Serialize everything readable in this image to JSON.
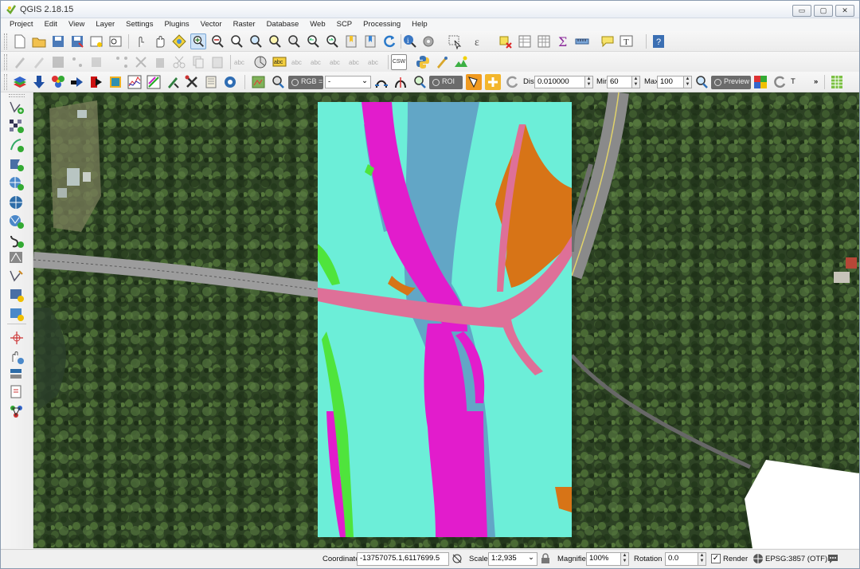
{
  "window": {
    "title": "QGIS 2.18.15",
    "btn_minimize": "▭",
    "btn_maximize": "▢",
    "btn_close": "✕"
  },
  "menu": [
    "Project",
    "Edit",
    "View",
    "Layer",
    "Settings",
    "Plugins",
    "Vector",
    "Raster",
    "Database",
    "Web",
    "SCP",
    "Processing",
    "Help"
  ],
  "scp_toolbar": {
    "rgb_label": "RGB =",
    "rgb_value": "-",
    "roi_label": "ROI",
    "dist_label": "Dist",
    "dist_value": "0.010000",
    "min_label": "Min",
    "min_value": "60",
    "max_label": "Max",
    "max_value": "100",
    "preview_label": "Preview",
    "t_label": "T",
    "more": "»"
  },
  "toolbar2": {
    "csw_label": "CSW",
    "abc": "abc"
  },
  "status": {
    "coordinate_label": "Coordinate",
    "coordinate_value": "-13757075.1,6117699.5",
    "scale_label": "Scale",
    "scale_value": "1:2,935",
    "magnifier_label": "Magnifier",
    "magnifier_value": "100%",
    "rotation_label": "Rotation",
    "rotation_value": "0.0",
    "render_label": "Render",
    "render_checked": "✓",
    "crs_label": "EPSG:3857 (OTF)"
  },
  "colors": {
    "class_cyan": "#6ceed8",
    "class_magenta": "#e21ccc",
    "class_blue": "#62a6c6",
    "class_orange": "#d77417",
    "class_pink": "#de7098",
    "class_green": "#4fe43c",
    "forest": "#2a3d22",
    "road": "#7c7c7c"
  }
}
